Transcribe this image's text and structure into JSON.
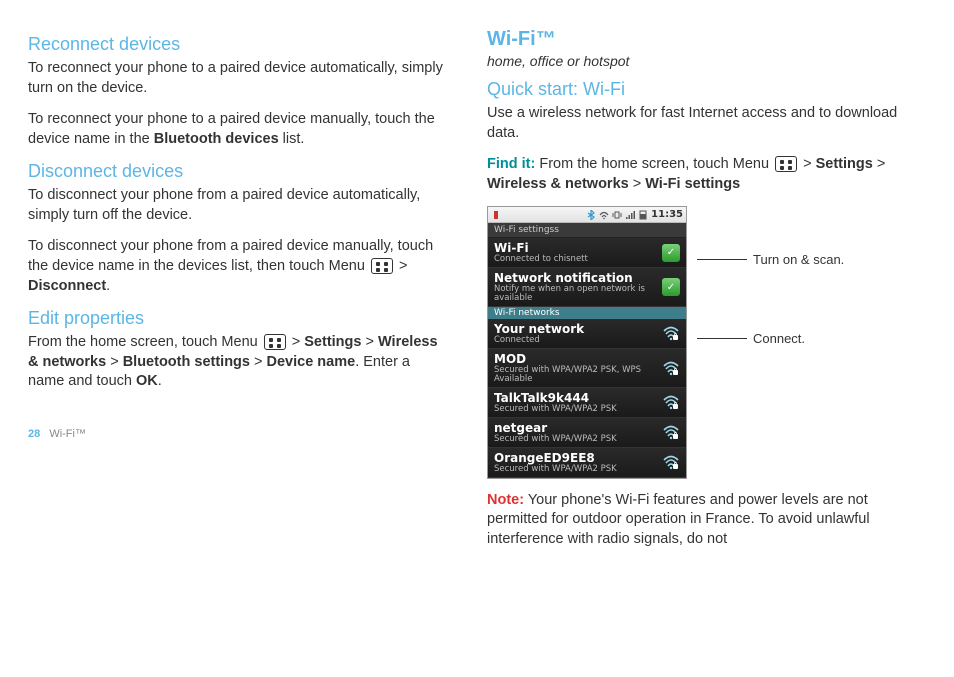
{
  "left": {
    "h_reconnect": "Reconnect devices",
    "p_reconnect1": "To reconnect your phone to a paired device automatically, simply turn on the device.",
    "p_reconnect2a": "To reconnect your phone to a paired device manually, touch the device name in the ",
    "p_reconnect2b": "Bluetooth devices",
    "p_reconnect2c": " list.",
    "h_disconnect": "Disconnect devices",
    "p_disc1": "To disconnect your phone from a paired device automatically, simply turn off the device.",
    "p_disc2a": "To disconnect your phone from a paired device manually, touch the device name in the devices list, then touch Menu ",
    "p_disc2b": " > ",
    "p_disc2c": "Disconnect",
    "p_disc2d": ".",
    "h_edit": "Edit properties",
    "p_edit1a": "From the home screen, touch Menu ",
    "p_edit1b": " > ",
    "p_edit1c": "Settings",
    "p_edit1d": " > ",
    "p_edit1e": "Wireless & networks",
    "p_edit1f": " > ",
    "p_edit1g": "Bluetooth settings",
    "p_edit1h": " > ",
    "p_edit1i": "Device name",
    "p_edit1j": ". Enter a name and touch ",
    "p_edit1k": "OK",
    "p_edit1l": "."
  },
  "right": {
    "h_wifi": "Wi-Fi™",
    "subtitle": "home, office or hotspot",
    "h_quick": "Quick start: Wi-Fi",
    "p_quick": "Use a wireless network for fast Internet access and to download data.",
    "find_label": "Find it:",
    "find_a": " From the home screen, touch Menu ",
    "find_b": " > ",
    "find_c": "Settings",
    "find_d": " > ",
    "find_e": "Wireless & networks",
    "find_f": " > ",
    "find_g": "Wi-Fi settings",
    "note_label": "Note:",
    "note_text": " Your phone's Wi-Fi features and power levels are not permitted for outdoor operation in France. To avoid unlawful interference with radio signals, do not"
  },
  "phone": {
    "time": "11:35",
    "titlebar": "Wi-Fi settingss",
    "wifi_title": "Wi-Fi",
    "wifi_sub": "Connected to chisnett",
    "net_title": "Network notification",
    "net_sub": "Notify me when an open network is available",
    "band": "Wi-Fi networks",
    "networks": [
      {
        "name": "Your network",
        "sub": "Connected"
      },
      {
        "name": "MOD",
        "sub": "Secured with WPA/WPA2 PSK, WPS Available"
      },
      {
        "name": "TalkTalk9k444",
        "sub": "Secured with WPA/WPA2 PSK"
      },
      {
        "name": "netgear",
        "sub": "Secured with WPA/WPA2 PSK"
      },
      {
        "name": "OrangeED9EE8",
        "sub": "Secured with WPA/WPA2 PSK"
      }
    ]
  },
  "callouts": {
    "c1": "Turn on & scan.",
    "c2": "Connect."
  },
  "footer": {
    "page": "28",
    "section": "Wi-Fi™"
  }
}
